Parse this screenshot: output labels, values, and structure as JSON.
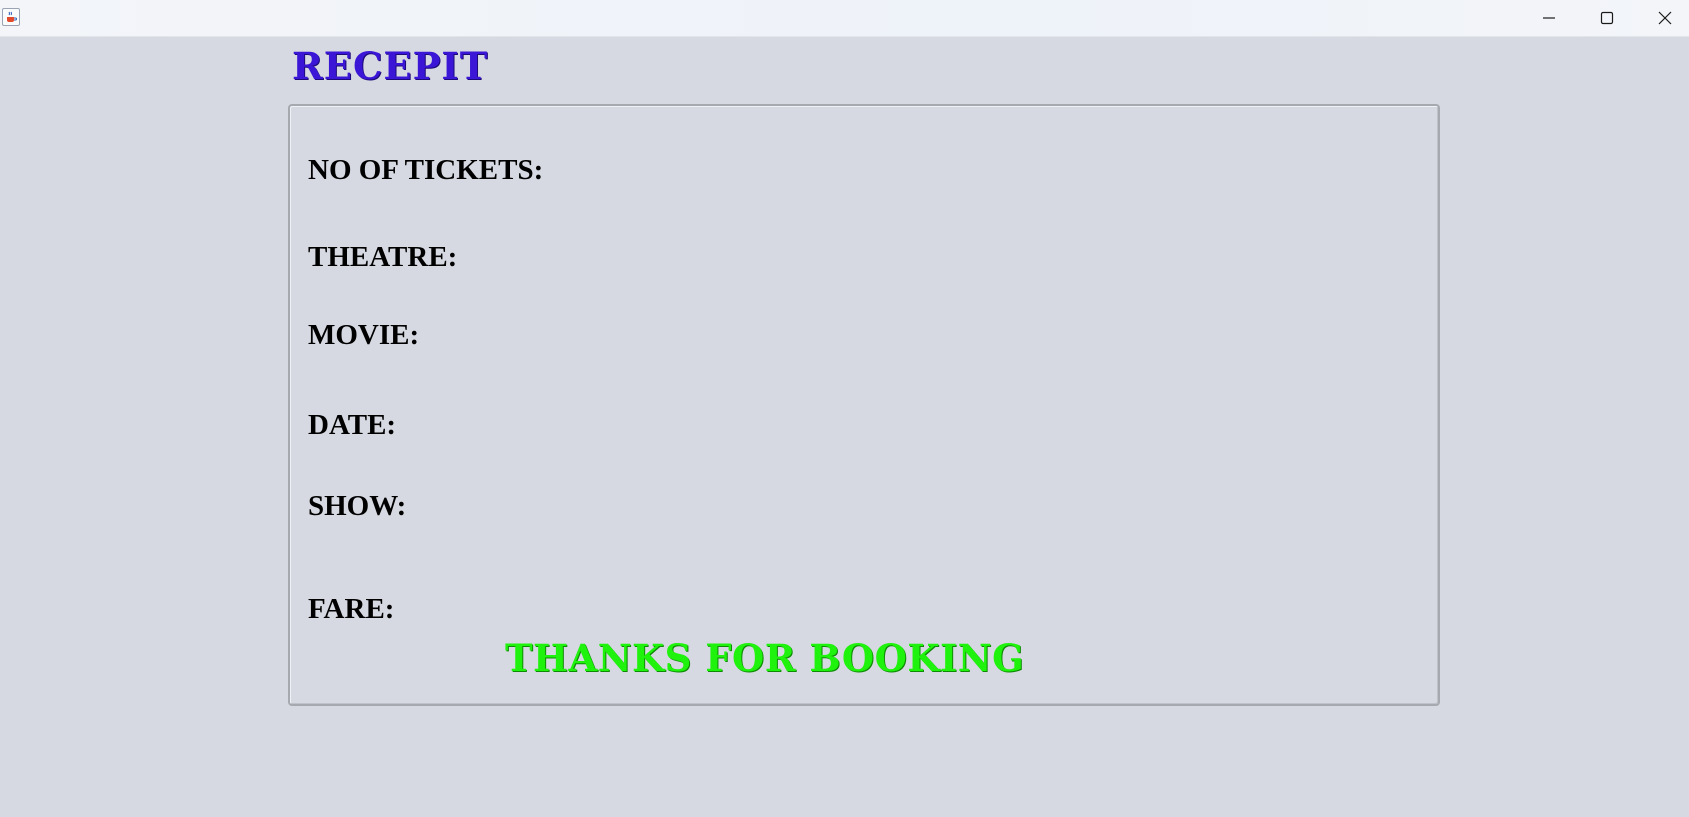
{
  "window": {
    "icon": "java-coffee-icon",
    "controls": {
      "minimize_icon": "minimize-icon",
      "maximize_icon": "maximize-icon",
      "close_icon": "close-icon"
    }
  },
  "receipt": {
    "title": "RECEPIT",
    "labels": {
      "tickets": "NO OF TICKETS:",
      "theatre": "THEATRE:",
      "movie": "MOVIE:",
      "date": "DATE:",
      "show": "SHOW:",
      "fare": "FARE:"
    },
    "thanks_message": "THANKS FOR BOOKING"
  },
  "colors": {
    "background": "#d6d9e1",
    "title": "#3b16d6",
    "thanks": "#1ff20c",
    "label": "#000000"
  }
}
